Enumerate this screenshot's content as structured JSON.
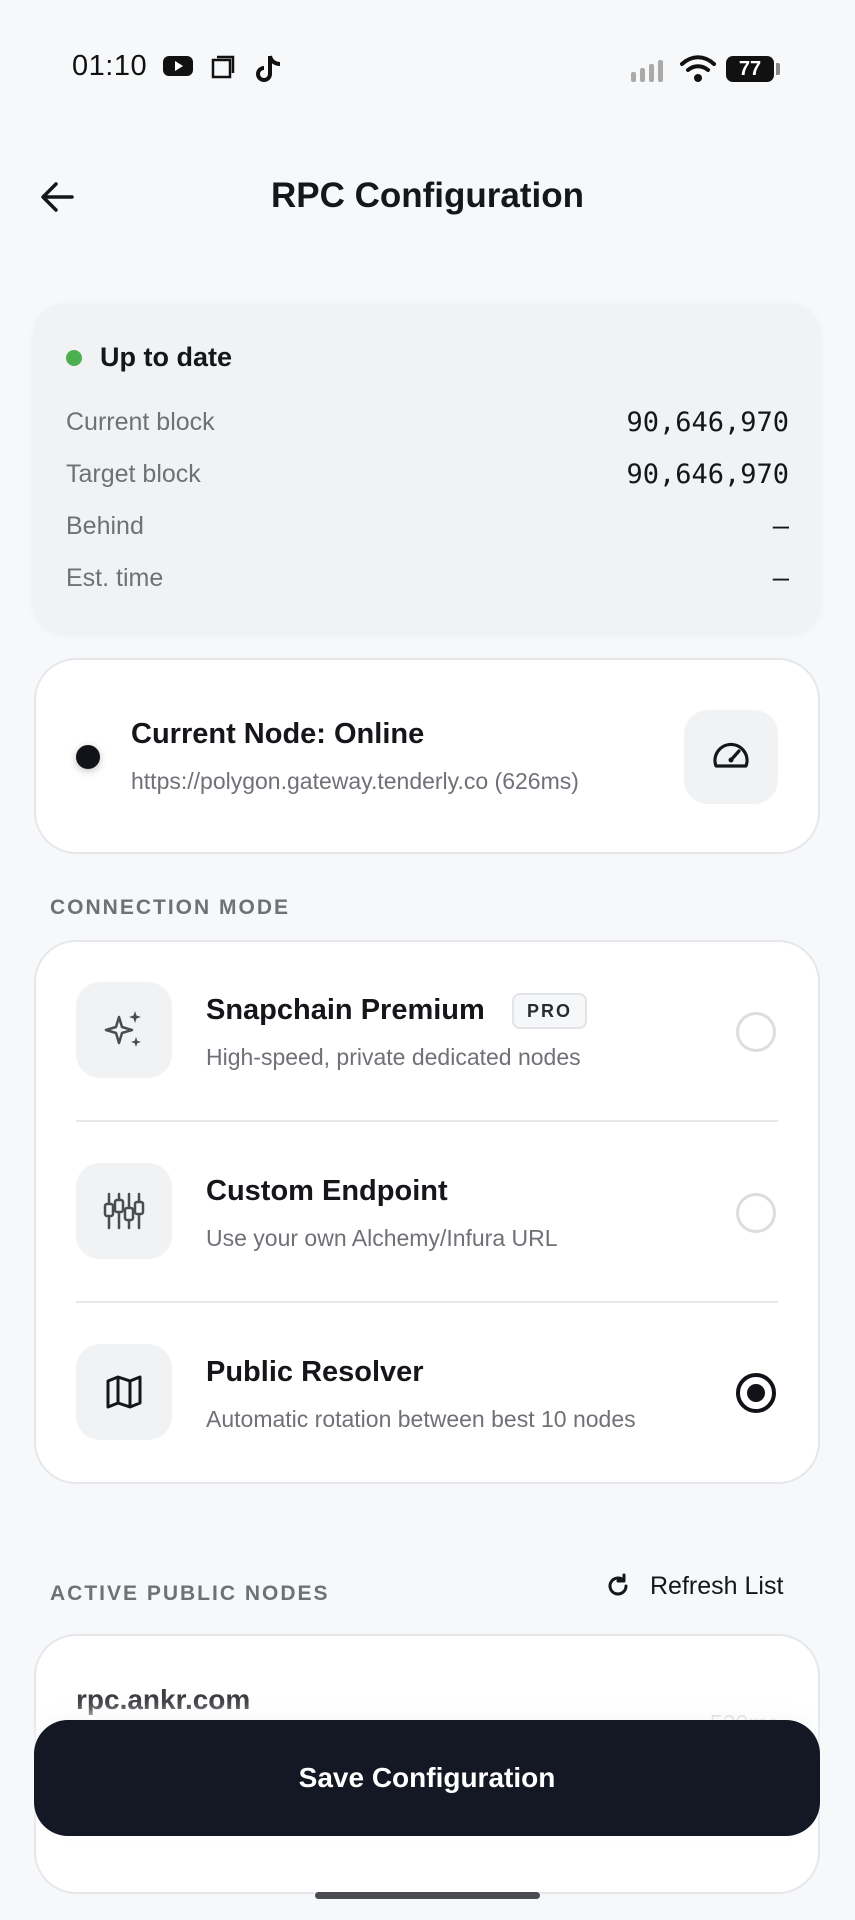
{
  "status_bar": {
    "time": "01:10",
    "battery": "77",
    "left_icons": [
      "youtube-icon",
      "screen-icon",
      "tiktok-icon"
    ],
    "right_icons": [
      "signal-icon",
      "wifi-icon",
      "battery-icon"
    ]
  },
  "header": {
    "title": "RPC Configuration",
    "back_icon": "arrow-left-icon"
  },
  "sync": {
    "status": "Up to date",
    "status_color": "#4caf50",
    "rows": [
      {
        "label": "Current block",
        "value": "90,646,970"
      },
      {
        "label": "Target block",
        "value": "90,646,970"
      },
      {
        "label": "Behind",
        "value": "—"
      },
      {
        "label": "Est. time",
        "value": "—"
      }
    ]
  },
  "current_node": {
    "title": "Current Node: Online",
    "url": "https://polygon.gateway.tenderly.co (626ms)",
    "action_icon": "speedometer-icon"
  },
  "connection_mode": {
    "label": "CONNECTION MODE",
    "options": [
      {
        "title": "Snapchain Premium",
        "badge": "PRO",
        "description": "High-speed, private dedicated nodes",
        "icon": "sparkles-icon",
        "selected": false
      },
      {
        "title": "Custom Endpoint",
        "description": "Use your own Alchemy/Infura URL",
        "icon": "sliders-icon",
        "selected": false
      },
      {
        "title": "Public Resolver",
        "description": "Automatic rotation between best 10 nodes",
        "icon": "map-icon",
        "selected": true
      }
    ]
  },
  "public_nodes": {
    "label": "ACTIVE PUBLIC NODES",
    "refresh_label": "Refresh List",
    "refresh_icon": "refresh-icon",
    "items": [
      {
        "host": "rpc.ankr.com",
        "latency": "520ms"
      }
    ]
  },
  "actions": {
    "save_label": "Save Configuration"
  },
  "colors": {
    "primary_dark": "#141824",
    "accent_green": "#4caf50",
    "background": "#f7f8fa"
  }
}
